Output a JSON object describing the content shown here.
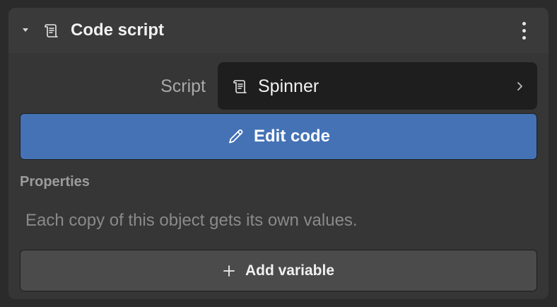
{
  "component": {
    "title": "Code script",
    "icon": "script-scroll-icon",
    "collapse_icon": "caret-down-icon",
    "menu_icon": "more-vertical-icon"
  },
  "script_row": {
    "label": "Script",
    "value": "Spinner",
    "value_icon": "script-scroll-icon",
    "chevron_icon": "chevron-right-icon"
  },
  "edit_button": {
    "label": "Edit code",
    "icon": "pencil-icon",
    "color": "#4472b5"
  },
  "properties": {
    "title": "Properties",
    "description": "Each copy of this object gets its own values."
  },
  "add_button": {
    "label": "Add variable",
    "icon": "plus-icon"
  }
}
